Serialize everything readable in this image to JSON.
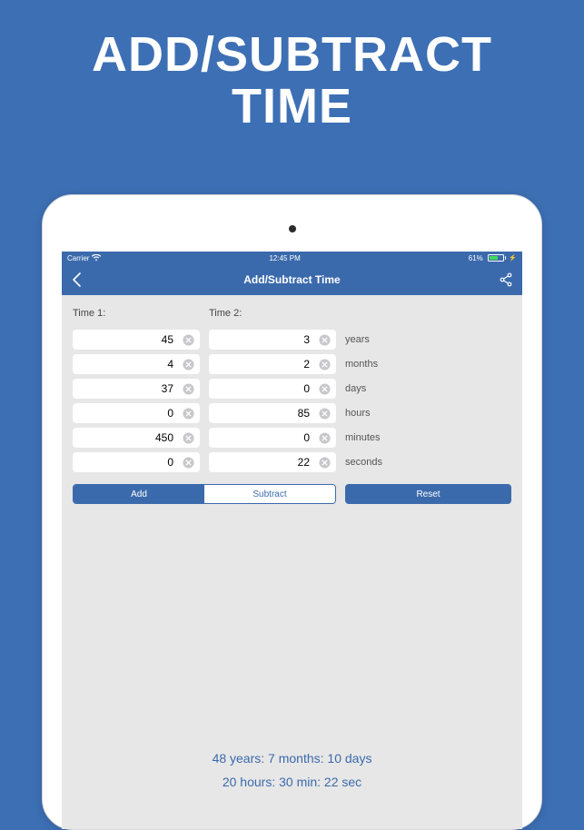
{
  "hero": {
    "line1": "ADD/SUBTRACT",
    "line2": "TIME"
  },
  "status": {
    "carrier": "Carrier",
    "time": "12:45 PM",
    "battery_pct": "61%"
  },
  "nav": {
    "title": "Add/Subtract Time"
  },
  "form": {
    "time1_label": "Time 1:",
    "time2_label": "Time 2:",
    "time1": {
      "years": "45",
      "months": "4",
      "days": "37",
      "hours": "0",
      "minutes": "450",
      "seconds": "0"
    },
    "time2": {
      "years": "3",
      "months": "2",
      "days": "0",
      "hours": "85",
      "minutes": "0",
      "seconds": "22"
    },
    "units": {
      "years": "years",
      "months": "months",
      "days": "days",
      "hours": "hours",
      "minutes": "minutes",
      "seconds": "seconds"
    }
  },
  "buttons": {
    "add": "Add",
    "subtract": "Subtract",
    "reset": "Reset"
  },
  "result": {
    "line1": "48 years: 7 months: 10 days",
    "line2": "20 hours: 30 min: 22 sec"
  }
}
